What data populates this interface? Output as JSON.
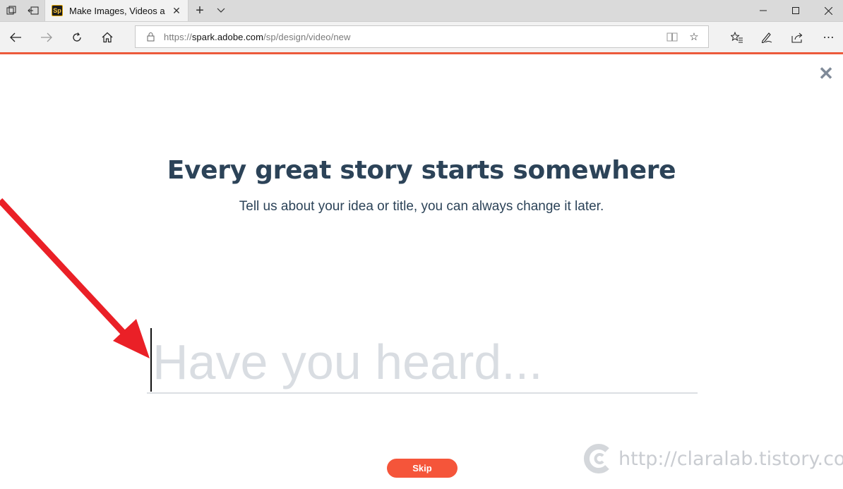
{
  "browser": {
    "tab": {
      "title": "Make Images, Videos ar",
      "favicon_text": "Sp"
    },
    "address": {
      "scheme_prefix": "https://",
      "host": "spark.adobe.com",
      "path": "/sp/design/video/new"
    },
    "accent_color": "#ec5a3c"
  },
  "page": {
    "headline": "Every great story starts somewhere",
    "subheadline": "Tell us about your idea or title, you can always change it later.",
    "title_input": {
      "value": "",
      "placeholder": "Have you heard..."
    },
    "skip_label": "Skip",
    "close_glyph": "✕",
    "skip_color": "#f5553a",
    "heading_color": "#2c4358"
  },
  "watermark": {
    "text": "http://claralab.tistory.com"
  }
}
